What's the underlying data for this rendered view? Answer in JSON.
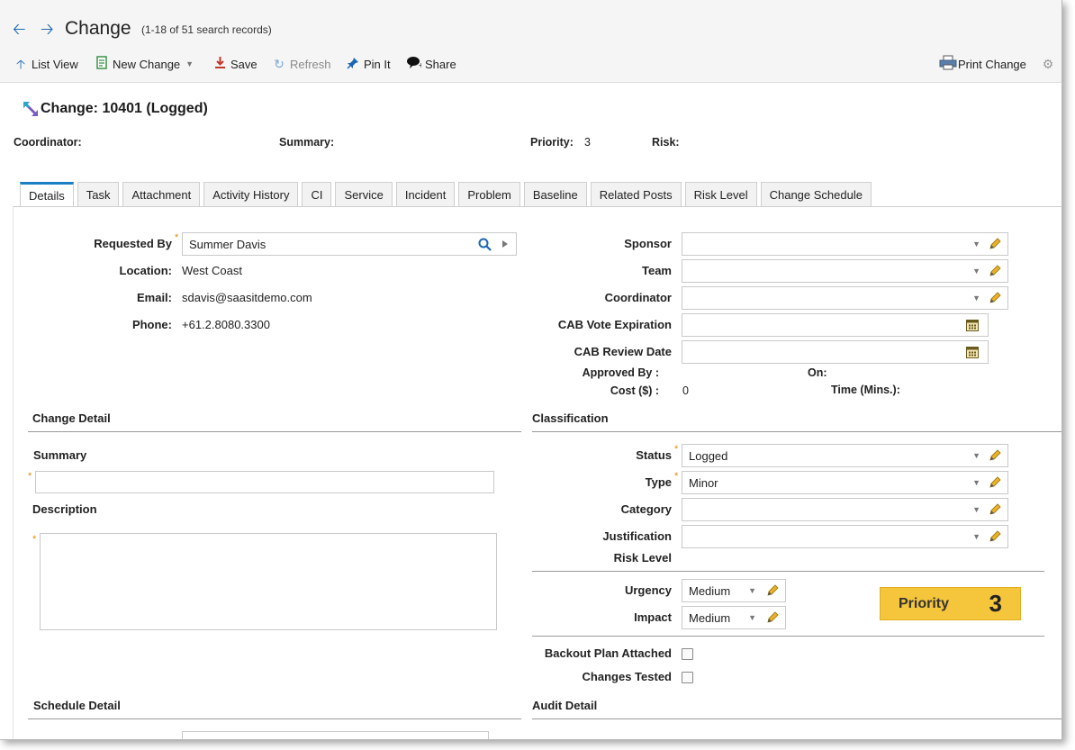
{
  "header": {
    "title": "Change",
    "record_count": "(1-18 of 51 search records)"
  },
  "toolbar": {
    "list_view": "List View",
    "new_change": "New Change",
    "save": "Save",
    "refresh": "Refresh",
    "pin_it": "Pin It",
    "share": "Share",
    "print_change": "Print Change"
  },
  "record": {
    "title": "Change: 10401 (Logged)",
    "coordinator_label": "Coordinator:",
    "summary_label": "Summary:",
    "priority_label": "Priority:",
    "priority_value": "3",
    "risk_label": "Risk:"
  },
  "tabs": [
    "Details",
    "Task",
    "Attachment",
    "Activity History",
    "CI",
    "Service",
    "Incident",
    "Problem",
    "Baseline",
    "Related Posts",
    "Risk Level",
    "Change Schedule"
  ],
  "requester": {
    "requested_by_label": "Requested By",
    "requested_by_value": "Summer Davis",
    "location_label": "Location:",
    "location_value": "West Coast",
    "email_label": "Email:",
    "email_value": "sdavis@saasitdemo.com",
    "phone_label": "Phone:",
    "phone_value": "+61.2.8080.3300"
  },
  "approval": {
    "sponsor_label": "Sponsor",
    "team_label": "Team",
    "coordinator_label": "Coordinator",
    "cab_vote_label": "CAB Vote Expiration",
    "cab_review_label": "CAB Review Date",
    "approved_by_label": "Approved By :",
    "on_label": "On:",
    "cost_label": "Cost ($) :",
    "cost_value": "0",
    "time_label": "Time (Mins.):"
  },
  "change_detail": {
    "section_title": "Change Detail",
    "summary_label": "Summary",
    "description_label": "Description"
  },
  "classification": {
    "section_title": "Classification",
    "status_label": "Status",
    "status_value": "Logged",
    "type_label": "Type",
    "type_value": "Minor",
    "category_label": "Category",
    "justification_label": "Justification",
    "risk_level_label": "Risk Level",
    "urgency_label": "Urgency",
    "urgency_value": "Medium",
    "impact_label": "Impact",
    "impact_value": "Medium",
    "priority_label": "Priority",
    "priority_value": "3",
    "backout_label": "Backout Plan Attached",
    "tested_label": "Changes Tested"
  },
  "schedule_detail": {
    "section_title": "Schedule Detail"
  },
  "audit_detail": {
    "section_title": "Audit Detail"
  },
  "colors": {
    "accent_blue": "#1b66b3",
    "priority_yellow": "#f5c53c",
    "required_orange": "#e88a00",
    "save_red": "#c0392b",
    "edit_pencil": "#d9a21b"
  }
}
